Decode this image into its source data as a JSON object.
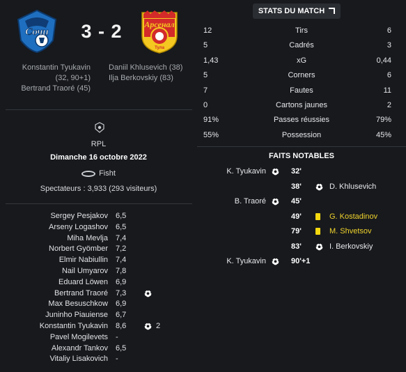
{
  "match": {
    "score": "3 - 2",
    "home_crest_text": "Сочи",
    "away_crest_text": "Арсенал",
    "away_crest_subtext": "Тула",
    "home_scorers": [
      "Konstantin Tyukavin",
      "(32, 90+1)",
      "Bertrand Traoré (45)"
    ],
    "away_scorers": [
      "Daniil Khlusevich (38)",
      "Ilja Berkovskiy (83)"
    ]
  },
  "info": {
    "league": "RPL",
    "date": "Dimanche 16 octobre 2022",
    "stadium": "Fisht",
    "attendance": "Spectateurs : 3,933 (293 visiteurs)"
  },
  "players": [
    {
      "name": "Sergey Pesjakov",
      "rating": "6,5",
      "goals": ""
    },
    {
      "name": "Arseny Logashov",
      "rating": "6,5",
      "goals": ""
    },
    {
      "name": "Miha Mevlja",
      "rating": "7,4",
      "goals": ""
    },
    {
      "name": "Norbert Gyömber",
      "rating": "7,2",
      "goals": ""
    },
    {
      "name": "Elmir Nabiullin",
      "rating": "7,4",
      "goals": ""
    },
    {
      "name": "Nail Umyarov",
      "rating": "7,8",
      "goals": ""
    },
    {
      "name": "Eduard Löwen",
      "rating": "6,9",
      "goals": ""
    },
    {
      "name": "Bertrand Traoré",
      "rating": "7,3",
      "goals": "1"
    },
    {
      "name": "Max Besuschkow",
      "rating": "6,9",
      "goals": ""
    },
    {
      "name": "Juninho Piauiense",
      "rating": "6,7",
      "goals": ""
    },
    {
      "name": "Konstantin Tyukavin",
      "rating": "8,6",
      "goals": "2"
    },
    {
      "name": "Pavel Mogilevets",
      "rating": "-",
      "goals": ""
    },
    {
      "name": "Alexandr Tankov",
      "rating": "6,5",
      "goals": ""
    },
    {
      "name": "Vitaliy Lisakovich",
      "rating": "-",
      "goals": ""
    }
  ],
  "stats": {
    "button_label": "STATS DU MATCH",
    "rows": [
      {
        "label": "Tirs",
        "home": "12",
        "away": "6"
      },
      {
        "label": "Cadrés",
        "home": "5",
        "away": "3"
      },
      {
        "label": "xG",
        "home": "1,43",
        "away": "0,44"
      },
      {
        "label": "Corners",
        "home": "5",
        "away": "6"
      },
      {
        "label": "Fautes",
        "home": "7",
        "away": "11"
      },
      {
        "label": "Cartons jaunes",
        "home": "0",
        "away": "2"
      },
      {
        "label": "Passes réussies",
        "home": "91%",
        "away": "79%"
      },
      {
        "label": "Possession",
        "home": "55%",
        "away": "45%"
      }
    ]
  },
  "events": {
    "title": "FAITS NOTABLES",
    "items": [
      {
        "side": "home",
        "type": "goal",
        "player": "K. Tyukavin",
        "minute": "32'"
      },
      {
        "side": "away",
        "type": "goal",
        "player": "D. Khlusevich",
        "minute": "38'"
      },
      {
        "side": "home",
        "type": "goal",
        "player": "B. Traoré",
        "minute": "45'"
      },
      {
        "side": "away",
        "type": "yellow",
        "player": "G. Kostadinov",
        "minute": "49'"
      },
      {
        "side": "away",
        "type": "yellow",
        "player": "M. Shvetsov",
        "minute": "79'"
      },
      {
        "side": "away",
        "type": "goal",
        "player": "I. Berkovskiy",
        "minute": "83'"
      },
      {
        "side": "home",
        "type": "goal",
        "player": "K. Tyukavin",
        "minute": "90'+1"
      }
    ]
  },
  "colors": {
    "background": "#17191d",
    "home_crest_primary": "#1f6fc0",
    "away_crest_primary": "#d32a2a",
    "away_crest_secondary": "#f4c820",
    "yellow_card": "#f5d80f"
  }
}
